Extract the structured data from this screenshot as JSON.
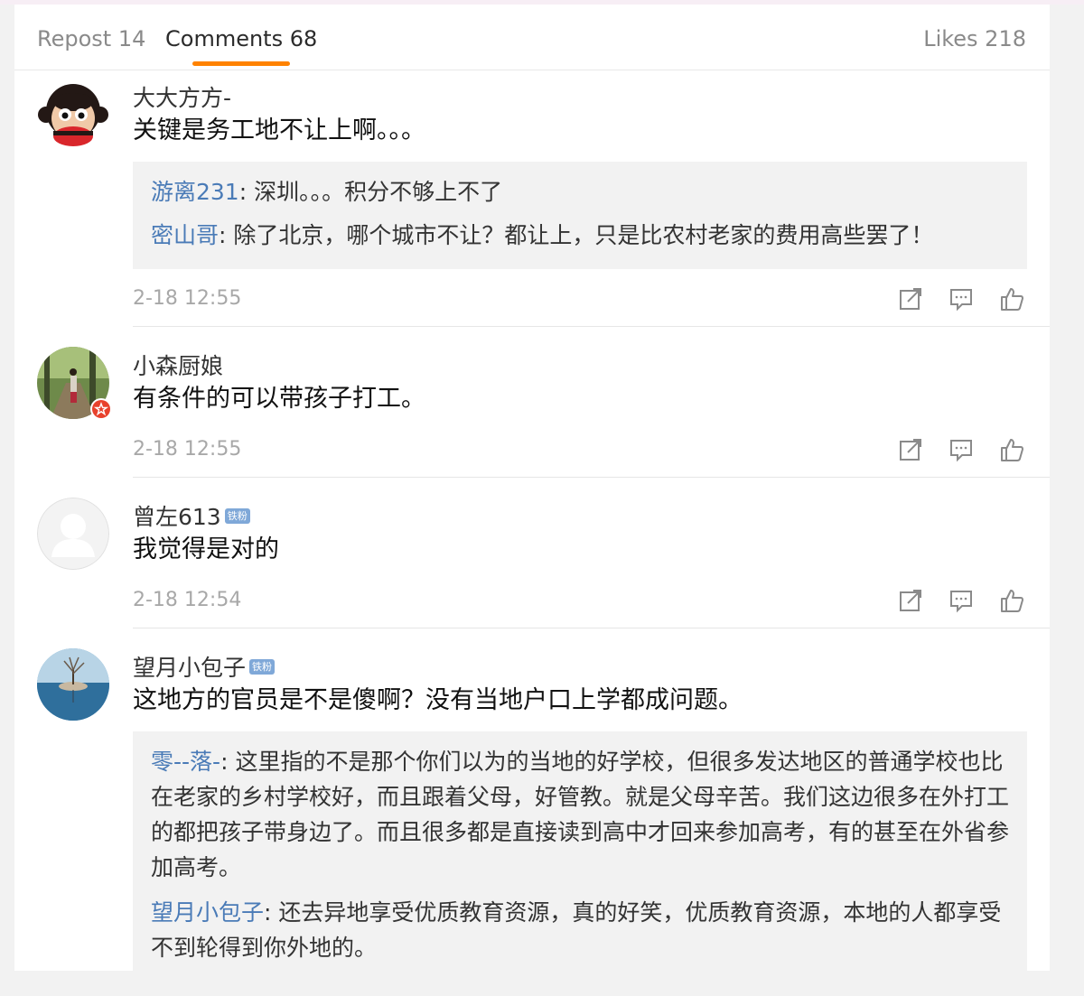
{
  "tabs": {
    "repost": "Repost 14",
    "comments": "Comments 68",
    "likes": "Likes 218"
  },
  "accent_color": "#ff8200",
  "reply_author_color": "#4a7bb7",
  "comments": [
    {
      "user": "大大方方-",
      "text": "关键是务工地不让上啊。。。",
      "avatar": "monkey-avatar",
      "replies": [
        {
          "author": "游离231",
          "text": ": 深圳。。。积分不够上不了"
        },
        {
          "author": "密山哥",
          "text": ": 除了北京，哪个城市不让？都让上，只是比农村老家的费用高些罢了！"
        }
      ],
      "time": "2-18 12:55"
    },
    {
      "user": "小森厨娘",
      "text": "有条件的可以带孩子打工。",
      "avatar": "forest-photo-avatar",
      "time": "2-18 12:55"
    },
    {
      "user": "曾左613",
      "badge": "铁粉",
      "text": "我觉得是对的",
      "avatar": "default-avatar",
      "time": "2-18 12:54"
    },
    {
      "user": "望月小包子",
      "badge": "铁粉",
      "text": "这地方的官员是不是傻啊？没有当地户口上学都成问题。",
      "avatar": "lake-tree-avatar",
      "replies": [
        {
          "author": "零--落-",
          "text": ": 这里指的不是那个你们以为的当地的好学校，但很多发达地区的普通学校也比在老家的乡村学校好，而且跟着父母，好管教。就是父母辛苦。我们这边很多在外打工的都把孩子带身边了。而且很多都是直接读到高中才回来参加高考，有的甚至在外省参加高考。"
        },
        {
          "author": "望月小包子",
          "text": ": 还去异地享受优质教育资源，真的好笑，优质教育资源，本地的人都享受不到轮得到你外地的。"
        }
      ]
    }
  ]
}
